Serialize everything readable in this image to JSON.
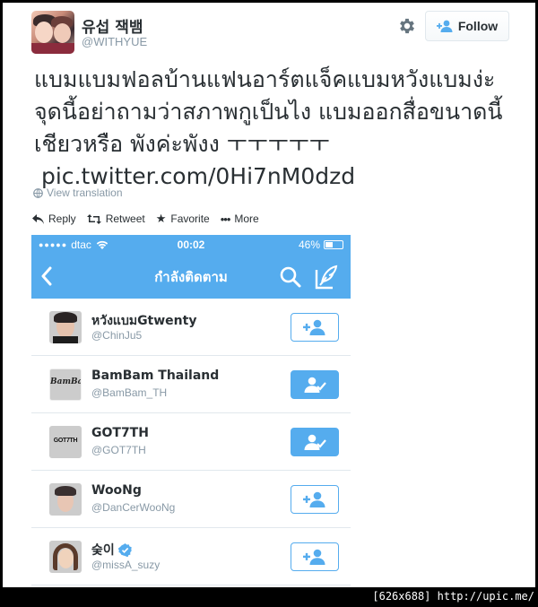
{
  "tweet": {
    "author_name": "유섭 잭뱀",
    "author_handle": "@WITHYUE",
    "follow_label": "Follow",
    "text_lines": [
      "แบมแบมฟอลบ้านแฟนอาร์ตแจ็คแบมหวังแบมง่ะ",
      "จุดนี้อย่าถามว่าสภาพกูเป็นไง แบมออกสื่อขนาดนี้",
      "เชียวหรือ พังค่ะพังง ㅜㅜㅜㅜㅜ",
      " pic.twitter.com/0Hi7nM0dzd"
    ],
    "view_translation": "View translation",
    "actions": {
      "reply": "Reply",
      "retweet": "Retweet",
      "favorite": "Favorite",
      "more": "More"
    }
  },
  "phone": {
    "carrier": "dtac",
    "signal_dots": "●●●●●",
    "time": "00:02",
    "battery": "46%",
    "battery_level": 0.46,
    "nav_title": "กำลังติดตาม",
    "rows": [
      {
        "name": "หวังแบมGtwenty",
        "handle": "@ChinJu5",
        "following": false,
        "verified": false
      },
      {
        "name": "BamBam Thailand",
        "handle": "@BamBam_TH",
        "following": true,
        "verified": false
      },
      {
        "name": "GOT7TH",
        "handle": "@GOT7TH",
        "following": true,
        "verified": false
      },
      {
        "name": "WooNg",
        "handle": "@DanCerWooNg",
        "following": false,
        "verified": false
      },
      {
        "name": "숮이",
        "handle": "@missA_suzy",
        "following": false,
        "verified": true
      }
    ],
    "avatar_texts": {
      "bambam_logo": "BamBam",
      "got7_logo": "GOT7TH"
    }
  },
  "watermark": "[626x688] http://upic.me/",
  "colors": {
    "twitter_blue": "#55acee",
    "text": "#292f33",
    "muted": "#8899a6"
  }
}
